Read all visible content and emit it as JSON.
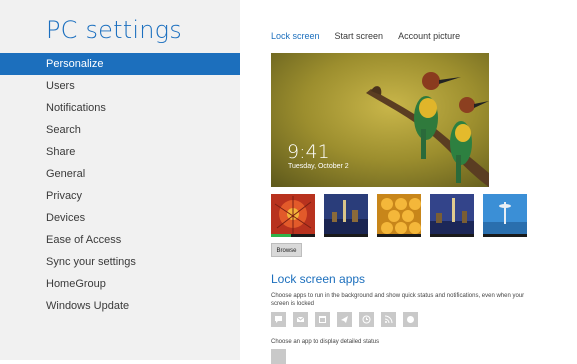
{
  "app": {
    "title": "PC settings"
  },
  "sidebar": {
    "items": [
      {
        "label": "Personalize",
        "active": true
      },
      {
        "label": "Users"
      },
      {
        "label": "Notifications"
      },
      {
        "label": "Search"
      },
      {
        "label": "Share"
      },
      {
        "label": "General"
      },
      {
        "label": "Privacy"
      },
      {
        "label": "Devices"
      },
      {
        "label": "Ease of Access"
      },
      {
        "label": "Sync your settings"
      },
      {
        "label": "HomeGroup"
      },
      {
        "label": "Windows Update"
      }
    ]
  },
  "tabs": [
    {
      "label": "Lock screen",
      "active": true
    },
    {
      "label": "Start screen"
    },
    {
      "label": "Account picture"
    }
  ],
  "lock_preview": {
    "time": "9:41",
    "date": "Tuesday, October 2"
  },
  "thumbnails": [
    {
      "icon": "red-flower-thumbnail"
    },
    {
      "icon": "city-night-thumbnail"
    },
    {
      "icon": "honeycomb-thumbnail"
    },
    {
      "icon": "city-night-thumbnail"
    },
    {
      "icon": "space-needle-thumbnail"
    }
  ],
  "browse": {
    "label": "Browse"
  },
  "lock_apps": {
    "title": "Lock screen apps",
    "description": "Choose apps to run in the background and show quick status and notifications, even when your screen is locked",
    "apps": [
      {
        "icon": "chat-icon"
      },
      {
        "icon": "mail-icon"
      },
      {
        "icon": "calendar-icon"
      },
      {
        "icon": "messaging-icon"
      },
      {
        "icon": "clock-icon"
      },
      {
        "icon": "rss-icon"
      },
      {
        "icon": "skype-icon"
      }
    ],
    "detailed_status": "Choose an app to display detailed status"
  },
  "colors": {
    "accent": "#1c6fbd",
    "sidebar_bg": "#f1f1f1",
    "tile_bg": "#c9c9c9"
  }
}
